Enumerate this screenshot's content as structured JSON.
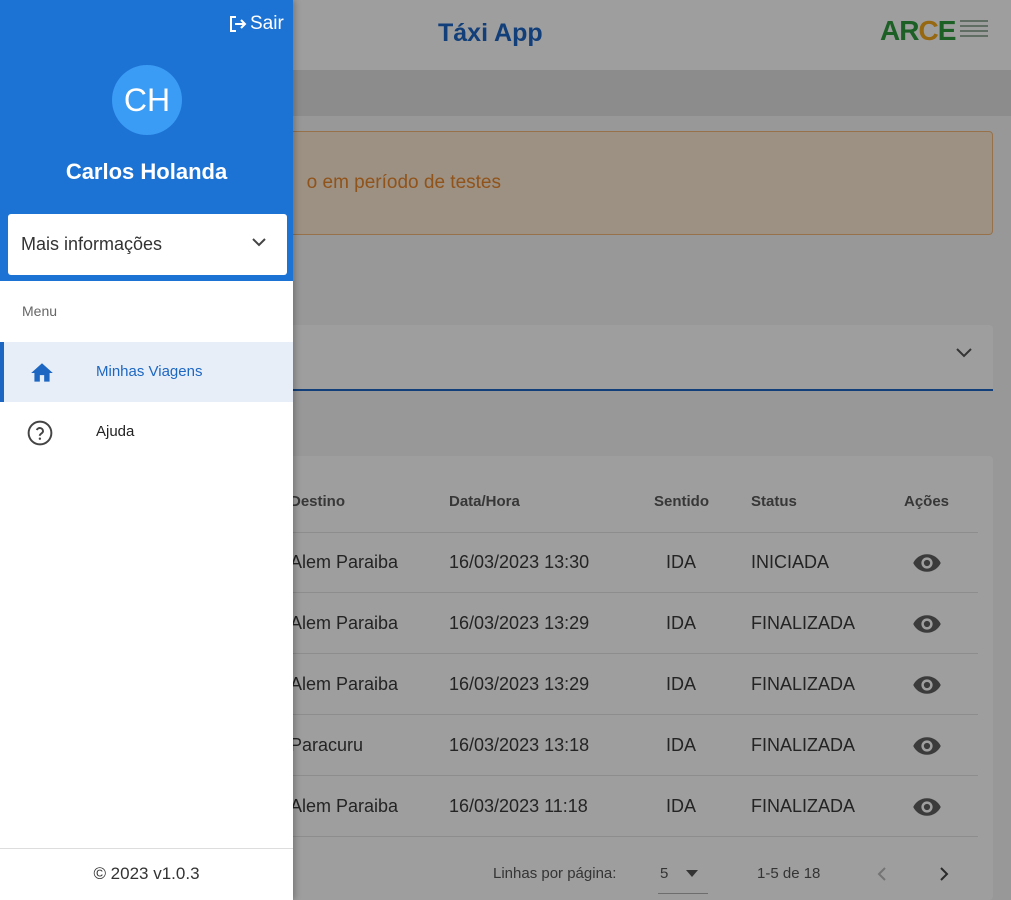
{
  "app": {
    "title": "Táxi App",
    "logo_text": "ARCE",
    "alert_text": "o em período de testes"
  },
  "table": {
    "headers": [
      "Destino",
      "Data/Hora",
      "Sentido",
      "Status",
      "Ações"
    ],
    "rows": [
      {
        "destino": "Alem Paraiba",
        "data_hora": "16/03/2023 13:30",
        "sentido": "IDA",
        "status": "INICIADA"
      },
      {
        "destino": "Alem Paraiba",
        "data_hora": "16/03/2023 13:29",
        "sentido": "IDA",
        "status": "FINALIZADA"
      },
      {
        "destino": "Alem Paraiba",
        "data_hora": "16/03/2023 13:29",
        "sentido": "IDA",
        "status": "FINALIZADA"
      },
      {
        "destino": "Paracuru",
        "data_hora": "16/03/2023 13:18",
        "sentido": "IDA",
        "status": "FINALIZADA"
      },
      {
        "destino": "Alem Paraiba",
        "data_hora": "16/03/2023 11:18",
        "sentido": "IDA",
        "status": "FINALIZADA"
      }
    ],
    "action_icon": "eye-icon",
    "footer": {
      "rows_per_page_label": "Linhas por página:",
      "rows_per_page_value": "5",
      "range_text": "1-5 de 18"
    }
  },
  "drawer": {
    "logout_label": "Sair",
    "avatar_initials": "CH",
    "user_name": "Carlos Holanda",
    "more_info_label": "Mais informações",
    "menu_caption": "Menu",
    "items": [
      {
        "label": "Minhas Viagens",
        "icon": "home-icon",
        "active": true
      },
      {
        "label": "Ajuda",
        "icon": "help-circle-icon",
        "active": false
      }
    ],
    "version": "© 2023 v1.0.3"
  },
  "colors": {
    "primary": "#1d73d4",
    "accent_text": "#1d67c3",
    "alert_bg": "#fdebd6",
    "alert_text": "#e8862b"
  }
}
